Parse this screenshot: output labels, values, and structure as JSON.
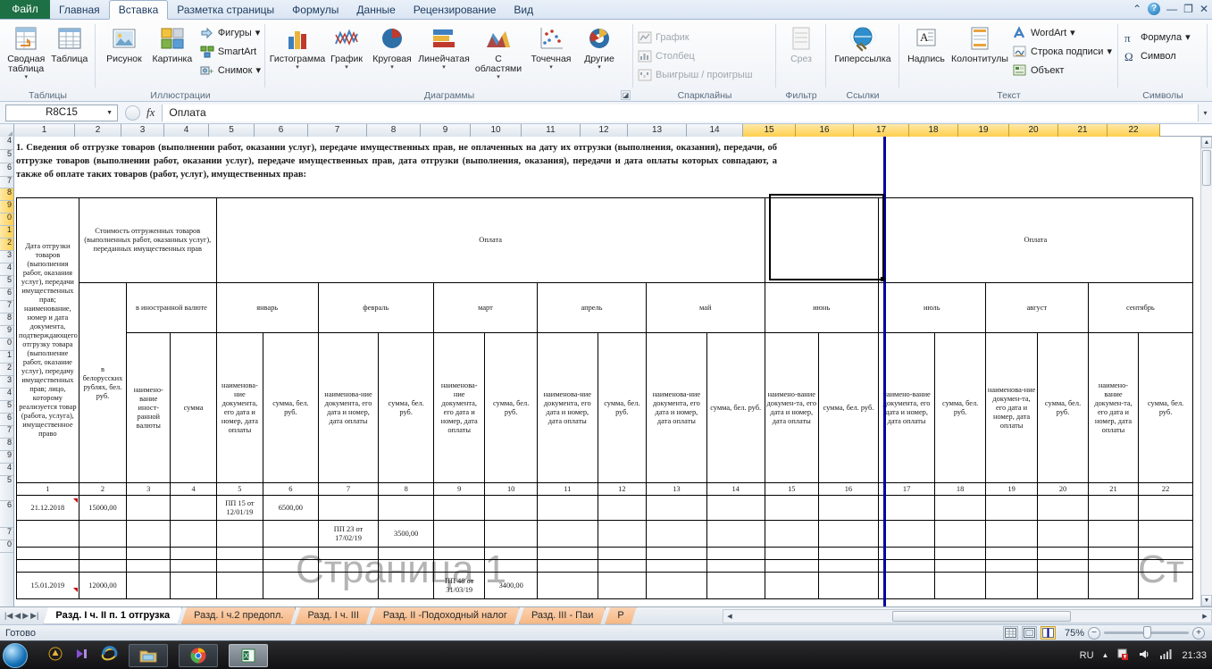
{
  "window": {
    "tabs": [
      "Файл",
      "Главная",
      "Вставка",
      "Разметка страницы",
      "Формулы",
      "Данные",
      "Рецензирование",
      "Вид"
    ],
    "active_tab": "Вставка",
    "minimize": "—",
    "restore": "❐",
    "close": "✕",
    "ribbon_collapse": "⌃",
    "help": "?"
  },
  "ribbon": {
    "groups": [
      {
        "title": "Таблицы",
        "buttons": [
          {
            "label": "Сводная таблица",
            "icon": "pivot-table-icon",
            "caret": "▾"
          },
          {
            "label": "Таблица",
            "icon": "table-icon",
            "caret": ""
          }
        ]
      },
      {
        "title": "Иллюстрации",
        "buttons": [
          {
            "label": "Рисунок",
            "icon": "picture-icon",
            "caret": ""
          },
          {
            "label": "Картинка",
            "icon": "clipart-icon",
            "caret": ""
          }
        ],
        "small_buttons": [
          {
            "label": "Фигуры",
            "icon": "shapes-icon",
            "caret": "▾"
          },
          {
            "label": "SmartArt",
            "icon": "smartart-icon",
            "caret": ""
          },
          {
            "label": "Снимок",
            "icon": "screenshot-icon",
            "caret": "▾"
          }
        ]
      },
      {
        "title": "Диаграммы",
        "buttons": [
          {
            "label": "Гистограмма",
            "icon": "column-chart-icon",
            "caret": "▾"
          },
          {
            "label": "График",
            "icon": "line-chart-icon",
            "caret": "▾"
          },
          {
            "label": "Круговая",
            "icon": "pie-chart-icon",
            "caret": "▾"
          },
          {
            "label": "Линейчатая",
            "icon": "bar-chart-icon",
            "caret": "▾"
          },
          {
            "label": "С областями",
            "icon": "area-chart-icon",
            "caret": "▾"
          },
          {
            "label": "Точечная",
            "icon": "scatter-chart-icon",
            "caret": "▾"
          },
          {
            "label": "Другие",
            "icon": "other-chart-icon",
            "caret": "▾"
          }
        ],
        "dialog_launcher": "◪"
      },
      {
        "title": "Спарклайны",
        "small_buttons": [
          {
            "label": "График",
            "icon": "sparkline-line-icon",
            "disabled": true
          },
          {
            "label": "Столбец",
            "icon": "sparkline-column-icon",
            "disabled": true
          },
          {
            "label": "Выигрыш / проигрыш",
            "icon": "sparkline-winloss-icon",
            "disabled": true
          }
        ]
      },
      {
        "title": "Фильтр",
        "buttons": [
          {
            "label": "Срез",
            "icon": "slicer-icon",
            "disabled": true,
            "caret": ""
          }
        ]
      },
      {
        "title": "Ссылки",
        "buttons": [
          {
            "label": "Гиперссылка",
            "icon": "hyperlink-icon",
            "caret": ""
          }
        ]
      },
      {
        "title": "Текст",
        "buttons": [
          {
            "label": "Надпись",
            "icon": "textbox-icon",
            "caret": ""
          },
          {
            "label": "Колонтитулы",
            "icon": "header-footer-icon",
            "caret": ""
          }
        ],
        "small_buttons": [
          {
            "label": "WordArt",
            "icon": "wordart-icon",
            "caret": "▾"
          },
          {
            "label": "Строка подписи",
            "icon": "signature-line-icon",
            "caret": "▾"
          },
          {
            "label": "Объект",
            "icon": "object-icon",
            "caret": ""
          }
        ]
      },
      {
        "title": "Символы",
        "small_buttons": [
          {
            "label": "Формула",
            "icon": "equation-icon",
            "caret": "▾"
          },
          {
            "label": "Символ",
            "icon": "symbol-icon",
            "caret": ""
          }
        ]
      }
    ]
  },
  "formula_bar": {
    "name_box": "R8C15",
    "formula_value": "Оплата",
    "cancel_icon": "cancel-icon",
    "fx_label": "fx",
    "expand_caret": "▾"
  },
  "grid": {
    "column_headers": [
      "1",
      "2",
      "3",
      "4",
      "5",
      "6",
      "7",
      "8",
      "9",
      "10",
      "11",
      "12",
      "13",
      "14",
      "15",
      "16",
      "17",
      "18",
      "19",
      "20",
      "21",
      "22"
    ],
    "selected_columns": [
      "15",
      "16",
      "17",
      "18",
      "19",
      "20",
      "21",
      "22"
    ],
    "row_headers": [
      "4",
      "5",
      "6",
      "7",
      "8",
      "9",
      "0",
      "1",
      "2",
      "3",
      "4",
      "5",
      "6",
      "7",
      "8",
      "9",
      "0",
      "1",
      "2",
      "3",
      "4",
      "5",
      "6",
      "7",
      "8",
      "9",
      "4",
      "5",
      "6",
      "7",
      "0"
    ],
    "watermark_main": "Страница 1",
    "watermark_right": "Ст"
  },
  "document": {
    "intro_text": "1. Сведения об отгрузке товаров (выполнении работ, оказании услуг), передаче имущественных прав, не оплаченных на дату их отгрузки (выполнения, оказания), передачи, об отгрузке товаров (выполнении работ, оказании услуг), передаче имущественных прав, дата отгрузки (выполнения, оказания), передачи и дата оплаты которых совпадают, а также об оплате таких товаров (работ, услуг), имущественных прав:",
    "col1_header": "Дата отгрузки товаров (выполнения работ, оказания услуг), передачи имущественных прав; наименование, номер и дата документа, подтверждающего отгрузку товара (выполнение работ, оказание услуг), передачу имущественных прав; лицо, которому реализуется товар (работа, услуга), имущественное право",
    "cost_header": "Стоимость отгруженных товаров (выполненных работ, оказанных услуг), переданных имущественных прав",
    "byn_header": "в белорусских рублях, бел. руб.",
    "foreign_header": "в иностранной валюте",
    "foreign_name": "наимено-вание иност-ранной валюты",
    "foreign_sum": "сумма",
    "payment_header": "Оплата",
    "payment_header_right": "Оплата",
    "months": [
      "январь",
      "февраль",
      "март",
      "апрель",
      "май",
      "июнь",
      "июль",
      "август",
      "сентябрь"
    ],
    "sub_doc_label": "наименова-ние документа, его дата и номер, дата оплаты",
    "sub_doc_label_b": "наименова-ние докумен-та, его дата и номер, дата оплаты",
    "sub_doc_label_c": "наимено-вание докумен-та, его дата и номер, дата оплаты",
    "sub_doc_label_d": "наимено-вание документа, его дата и номер, дата оплаты",
    "sub_doc_label_e": "наименова-ние докумен-та, его дата и номер, дата оплаты",
    "sub_sum_label": "сумма, бел. руб.",
    "numbering_row": [
      "1",
      "2",
      "3",
      "4",
      "5",
      "6",
      "7",
      "8",
      "9",
      "10",
      "11",
      "12",
      "13",
      "14",
      "15",
      "16",
      "17",
      "18",
      "19",
      "20",
      "21",
      "22"
    ],
    "data_rows": [
      {
        "c1": "21.12.2018",
        "c2": "15000,00",
        "c5": "ПП 15 от 12/01/19",
        "c6": "6500,00"
      },
      {
        "c7": "ПП 23 от 17/02/19",
        "c8": "3500,00"
      },
      {},
      {},
      {
        "c1": "15.01.2019",
        "c2": "12000,00",
        "c9": "ПП 48 от 31/03/19",
        "c10": "3400,00"
      }
    ]
  },
  "sheet_tabs": {
    "nav": [
      "|◀",
      "◀",
      "▶",
      "▶|"
    ],
    "tabs": [
      {
        "label": "Разд. I ч. II п. 1 отгрузка",
        "active": true
      },
      {
        "label": "Разд. I ч.2 предопл.",
        "active": false
      },
      {
        "label": "Разд. I ч. III",
        "active": false
      },
      {
        "label": "Разд. II -Подоходный налог",
        "active": false
      },
      {
        "label": "Разд. III - Паи",
        "active": false
      },
      {
        "label": "Р",
        "active": false
      }
    ]
  },
  "status_bar": {
    "text": "Готово",
    "zoom": "75%",
    "zoom_out": "−",
    "zoom_in": "+",
    "views": [
      "normal-view-icon",
      "page-layout-view-icon",
      "page-break-preview-icon"
    ]
  },
  "taskbar": {
    "start": "start-orb-icon",
    "items": [
      "antivirus-icon",
      "media-player-icon",
      "internet-explorer-icon",
      "explorer-icon",
      "chrome-icon",
      "excel-icon"
    ],
    "language": "RU",
    "tray_up": "▲",
    "tray_icons": [
      "action-center-icon",
      "volume-icon",
      "network-icon"
    ],
    "clock": "21:33"
  },
  "colors": {
    "file_tab": "#1d7044",
    "selection_header": "#ffcf4d",
    "page_break": "#0000a0",
    "sheet_tab": "#f6b884"
  }
}
